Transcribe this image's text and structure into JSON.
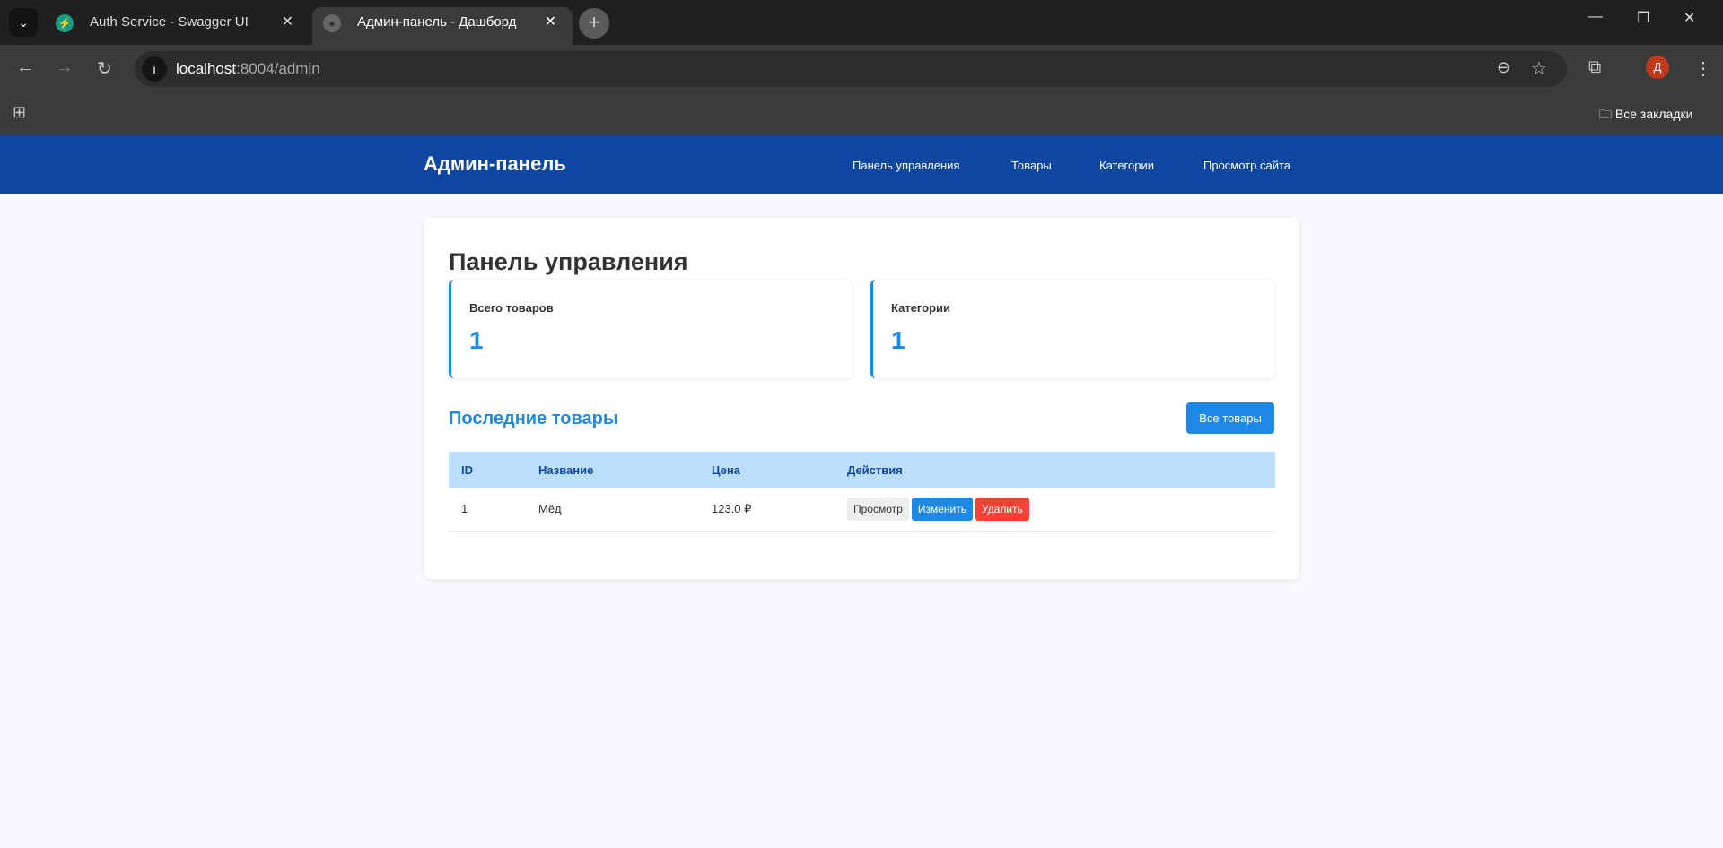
{
  "browser": {
    "tabs": [
      {
        "title": "Auth Service - Swagger UI",
        "active": false
      },
      {
        "title": "Админ-панель - Дашборд",
        "active": true
      }
    ],
    "url_host": "localhost",
    "url_path": ":8004/admin",
    "profile_initial": "Д",
    "bookmarks_label": "Все закладки"
  },
  "header": {
    "brand": "Админ-панель",
    "nav": [
      "Панель управления",
      "Товары",
      "Категории",
      "Просмотр сайта"
    ]
  },
  "main": {
    "title": "Панель управления",
    "stats": [
      {
        "label": "Всего товаров",
        "value": "1"
      },
      {
        "label": "Категории",
        "value": "1"
      }
    ],
    "recent_title": "Последние товары",
    "all_button": "Все товары",
    "table": {
      "headers": [
        "ID",
        "Название",
        "Цена",
        "Действия"
      ],
      "rows": [
        {
          "id": "1",
          "name": "Мёд",
          "price": "123.0 ₽",
          "actions": [
            "Просмотр",
            "Изменить",
            "Удалить"
          ]
        }
      ]
    }
  },
  "colors": {
    "primary": "#0d47a1",
    "accent": "#1e88e5",
    "danger": "#f44336",
    "table_header": "#bbdefb"
  }
}
